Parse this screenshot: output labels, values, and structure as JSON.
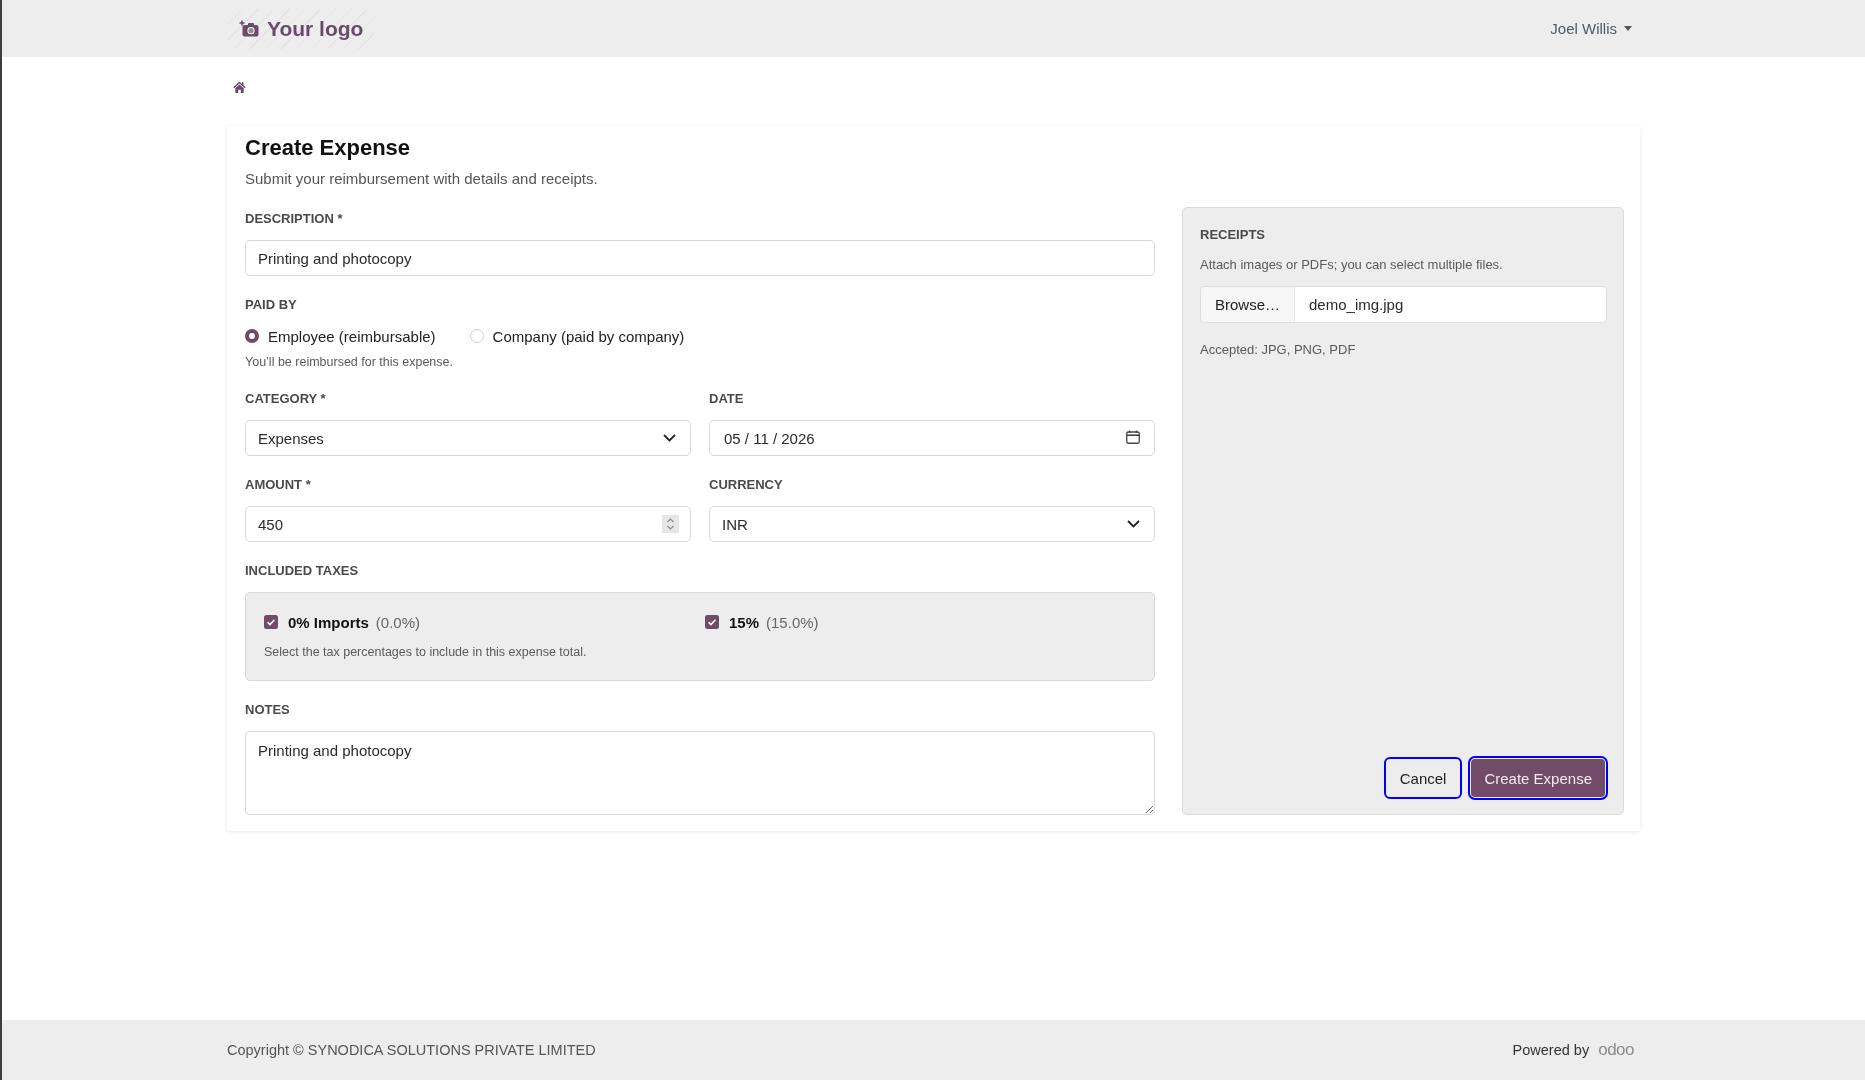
{
  "header": {
    "logo": "Your logo",
    "user": "Joel Willis"
  },
  "form": {
    "title": "Create Expense",
    "subtitle": "Submit your reimbursement with details and receipts.",
    "description": {
      "label": "DESCRIPTION *",
      "value": "Printing and photocopy"
    },
    "paid_by": {
      "label": "PAID BY",
      "options": [
        {
          "label": "Employee (reimbursable)",
          "selected": true
        },
        {
          "label": "Company (paid by company)",
          "selected": false
        }
      ],
      "help": "You’ll be reimbursed for this expense."
    },
    "category": {
      "label": "CATEGORY *",
      "value": "Expenses"
    },
    "date": {
      "label": "DATE",
      "value": "05 / 11 / 2026"
    },
    "amount": {
      "label": "AMOUNT *",
      "value": "450"
    },
    "currency": {
      "label": "CURRENCY",
      "value": "INR"
    },
    "taxes": {
      "label": "INCLUDED TAXES",
      "items": [
        {
          "name": "0% Imports",
          "rate": "(0.0%)",
          "checked": true
        },
        {
          "name": "15%",
          "rate": "(15.0%)",
          "checked": true
        }
      ],
      "help": "Select the tax percentages to include in this expense total."
    },
    "notes": {
      "label": "NOTES",
      "value": "Printing and photocopy"
    }
  },
  "receipts": {
    "label": "RECEIPTS",
    "hint": "Attach images or PDFs; you can select multiple files.",
    "browse": "Browse…",
    "file": "demo_img.jpg",
    "accepted": "Accepted: JPG, PNG, PDF",
    "actions": [
      {
        "label": "Cancel",
        "kind": "secondary"
      },
      {
        "label": "Create Expense",
        "kind": "primary"
      }
    ]
  },
  "footer": {
    "copyright": "Copyright © SYNODICA SOLUTIONS PRIVATE LIMITED",
    "powered_by": "Powered by",
    "brand": "odoo"
  }
}
